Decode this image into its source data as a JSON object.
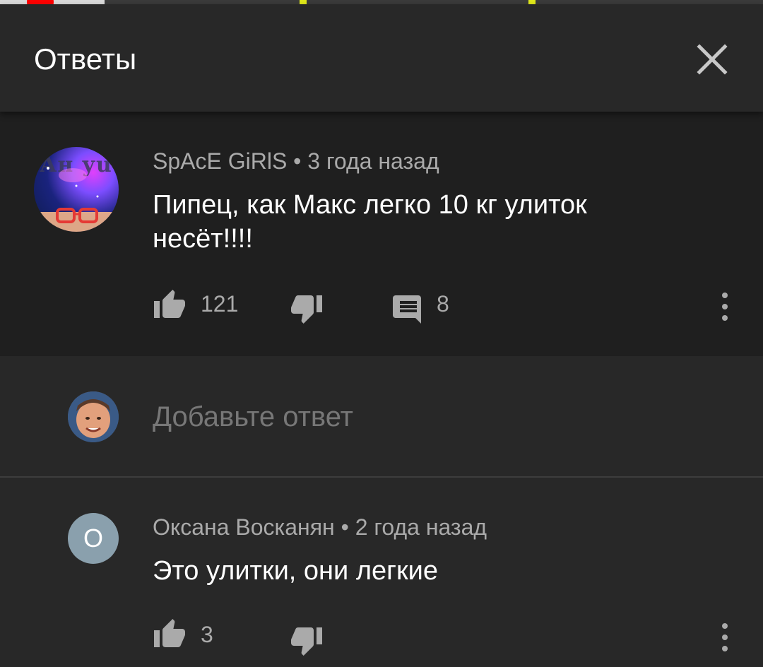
{
  "header": {
    "title": "Ответы"
  },
  "parent_comment": {
    "avatar_text": "Ан уu",
    "author": "SpAcE GiRlS",
    "time": "3 года назад",
    "text": "Пипец, как Макс легко 10 кг улиток несёт!!!!",
    "likes": "121",
    "replies": "8"
  },
  "add_reply": {
    "placeholder": "Добавьте ответ"
  },
  "replies": [
    {
      "avatar_letter": "О",
      "author": "Оксана Восканян",
      "time": "2 года назад",
      "text": "Это улитки, они легкие",
      "likes": "3"
    }
  ],
  "colors": {
    "background": "#282828",
    "comment_bg": "#1f1f1f",
    "accent": "#ff0000",
    "secondary_text": "#aaaaaa"
  },
  "icons": [
    "close-icon",
    "thumb-up-icon",
    "thumb-down-icon",
    "reply-icon",
    "more-vert-icon"
  ]
}
